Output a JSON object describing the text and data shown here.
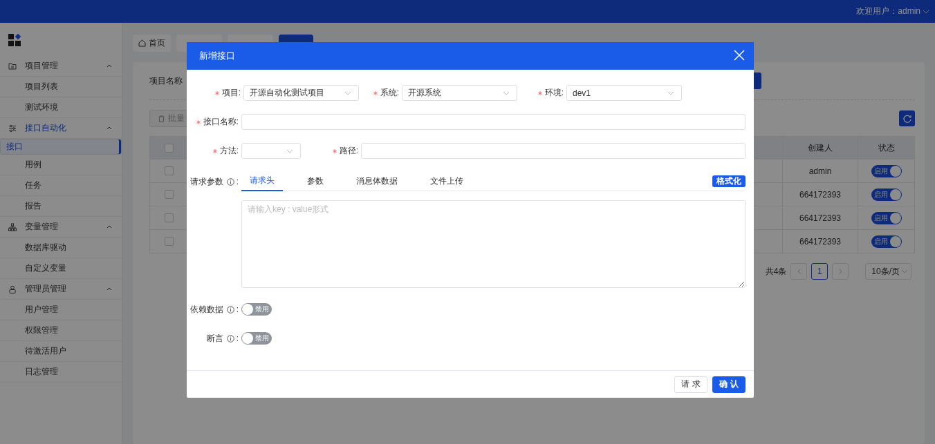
{
  "header": {
    "greeting": "欢迎用户：admin"
  },
  "sidebar": {
    "groups": [
      {
        "label": "项目管理",
        "active": false,
        "expanded": true,
        "children": [
          {
            "label": "项目列表",
            "selected": false
          },
          {
            "label": "测试环境",
            "selected": false
          }
        ]
      },
      {
        "label": "接口自动化",
        "active": true,
        "expanded": true,
        "children": [
          {
            "label": "接口",
            "selected": true
          },
          {
            "label": "用例",
            "selected": false
          },
          {
            "label": "任务",
            "selected": false
          },
          {
            "label": "报告",
            "selected": false
          }
        ]
      },
      {
        "label": "变量管理",
        "active": false,
        "expanded": true,
        "children": [
          {
            "label": "数据库驱动",
            "selected": false
          },
          {
            "label": "自定义变量",
            "selected": false
          }
        ]
      },
      {
        "label": "管理员管理",
        "active": false,
        "expanded": true,
        "children": [
          {
            "label": "用户管理",
            "selected": false
          },
          {
            "label": "权限管理",
            "selected": false
          },
          {
            "label": "待激活用户",
            "selected": false
          },
          {
            "label": "日志管理",
            "selected": false
          }
        ]
      }
    ]
  },
  "tabs": [
    {
      "label": "首页",
      "selected": false
    },
    {
      "selected": false
    },
    {
      "selected": false
    },
    {
      "selected": true
    }
  ],
  "filter": {
    "label": "项目名称"
  },
  "toolbar": {
    "batch_button": "批量"
  },
  "table": {
    "all_checked": false,
    "columns": [
      "创建人",
      "状态"
    ],
    "rows": [
      {
        "checked": false,
        "creator": "admin",
        "status": "启用",
        "enabled": true
      },
      {
        "checked": false,
        "creator": "664172393",
        "status": "启用",
        "enabled": true
      },
      {
        "checked": false,
        "creator": "664172393",
        "status": "启用",
        "enabled": true
      },
      {
        "checked": false,
        "creator": "664172393",
        "status": "启用",
        "enabled": true
      }
    ]
  },
  "pagination": {
    "total": "共4条",
    "pages": [
      {
        "label": "1",
        "selected": true
      }
    ],
    "page_size": "10条/页"
  },
  "dialog": {
    "title": "新增接口",
    "selects": [
      {
        "label": "项目:",
        "value": "开源自动化测试项目",
        "required": true
      },
      {
        "label": "系统:",
        "value": "开源系统",
        "required": true
      },
      {
        "label": "环境:",
        "value": "dev1",
        "required": true
      }
    ],
    "name_field": {
      "label": "接口名称:",
      "required": true
    },
    "method_field": {
      "label": "方法:",
      "required": true
    },
    "path_field": {
      "label": "路径:",
      "required": true
    },
    "params": {
      "label": "请求参数",
      "colon": ":",
      "tabs": [
        {
          "label": "请求头",
          "selected": true
        },
        {
          "label": "参数",
          "selected": false
        },
        {
          "label": "消息体数据",
          "selected": false
        },
        {
          "label": "文件上传",
          "selected": false
        }
      ],
      "format_button": "格式化",
      "placeholder": "请输入key : value形式"
    },
    "options": [
      {
        "label": "依赖数据",
        "colon": ":",
        "switch_text": "禁用",
        "enabled": false
      },
      {
        "label": "断言",
        "colon": ":",
        "switch_text": "禁用",
        "enabled": false
      }
    ],
    "buttons": [
      {
        "label": "请 求",
        "kind": "plain"
      },
      {
        "label": "确 认",
        "kind": "primary"
      }
    ]
  }
}
